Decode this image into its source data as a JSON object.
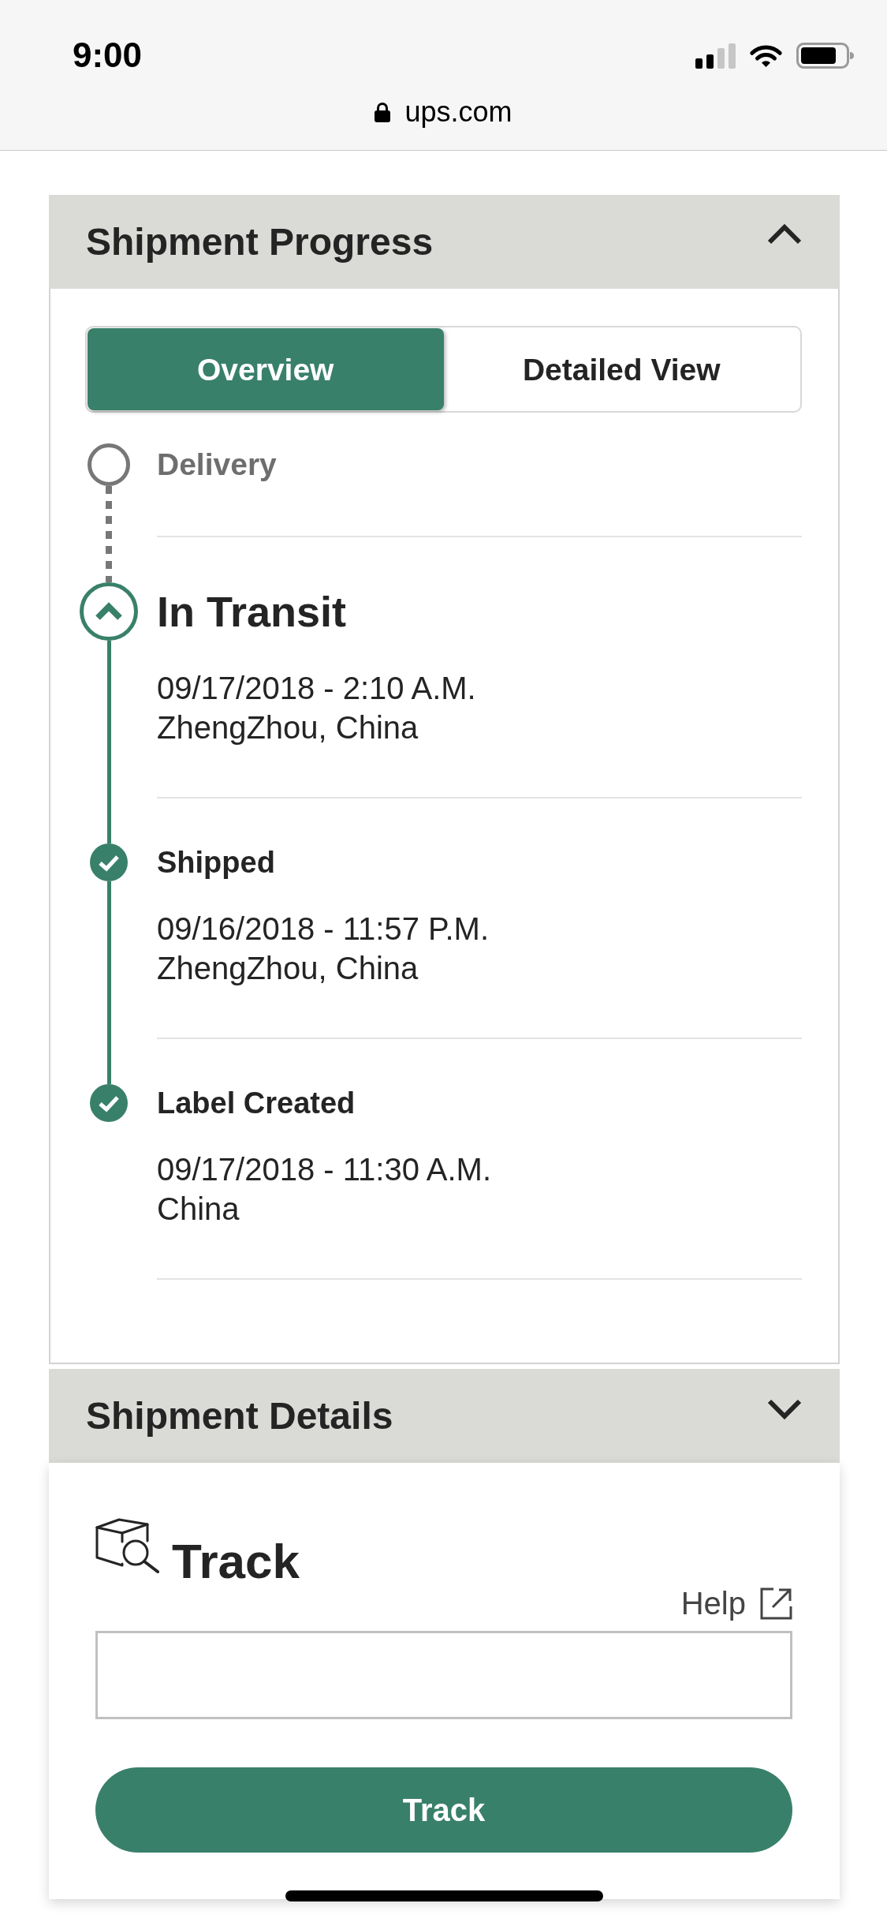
{
  "status_bar": {
    "time": "9:00",
    "url": "ups.com"
  },
  "shipment_progress": {
    "title": "Shipment Progress",
    "expanded": true,
    "tabs": [
      {
        "label": "Overview",
        "selected": true
      },
      {
        "label": "Detailed View",
        "selected": false
      }
    ],
    "milestones": [
      {
        "kind": "pending",
        "title": "Delivery"
      },
      {
        "kind": "current",
        "title": "In Transit",
        "date": "09/17/2018 - 2:10 A.M.",
        "location": "ZhengZhou, China"
      },
      {
        "kind": "done",
        "title": "Shipped",
        "date": "09/16/2018 - 11:57 P.M.",
        "location": "ZhengZhou, China"
      },
      {
        "kind": "done",
        "title": "Label Created",
        "date": "09/17/2018 - 11:30 A.M.",
        "location": "China"
      }
    ]
  },
  "shipment_details": {
    "title": "Shipment Details",
    "expanded": false
  },
  "track": {
    "title": "Track",
    "help_link": "Help",
    "button": "Track"
  }
}
